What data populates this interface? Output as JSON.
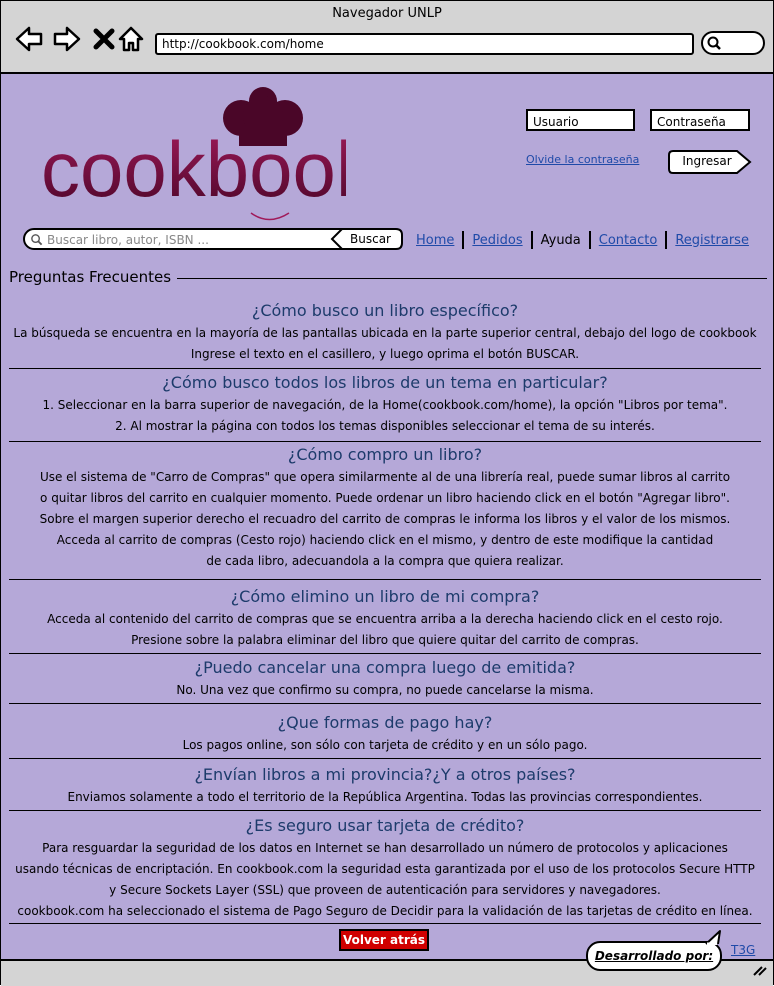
{
  "window": {
    "title": "Navegador UNLP"
  },
  "browser": {
    "url": "http://cookbook.com/home"
  },
  "logo": {
    "text": "cookbook"
  },
  "login": {
    "user_placeholder": "Usuario",
    "password_placeholder": "Contraseña",
    "forgot_label": "Olvide la contraseña",
    "login_label": "Ingresar"
  },
  "search": {
    "placeholder": "Buscar libro, autor, ISBN ...",
    "button_label": "Buscar"
  },
  "nav": {
    "home": "Home",
    "orders": "Pedidos",
    "help": "Ayuda",
    "contact": "Contacto",
    "register": "Registrarse"
  },
  "faq": {
    "heading": "Preguntas Frecuentes",
    "items": [
      {
        "q": "¿Cómo busco un libro específico?",
        "a": [
          "La búsqueda se encuentra en la mayoría de las pantallas ubicada en la parte superior central, debajo del logo de cookbook",
          "Ingrese el texto en el casillero, y luego oprima el botón BUSCAR."
        ]
      },
      {
        "q": "¿Cómo busco todos los libros de un tema en particular?",
        "a": [
          "1. Seleccionar en la barra superior de navegación, de la Home(cookbook.com/home), la opción \"Libros por tema\".",
          "2. Al mostrar la página con todos los temas disponibles seleccionar el tema de su interés."
        ]
      },
      {
        "q": "¿Cómo compro un libro?",
        "a": [
          "Use el sistema de \"Carro de Compras\" que opera similarmente al de una librería real, puede sumar libros al carrito",
          "o quitar libros del carrito en cualquier momento. Puede ordenar un libro haciendo click en el botón \"Agregar libro\".",
          "Sobre el margen superior derecho el recuadro del carrito de compras le informa los libros y el valor de los mismos.",
          "Acceda al carrito de compras (Cesto rojo) haciendo click en el mismo, y dentro de este modifique la cantidad",
          "de cada libro, adecuandola a la compra que quiera realizar."
        ]
      },
      {
        "q": "¿Cómo elimino un libro de mi compra?",
        "a": [
          "Acceda al contenido del carrito de compras que se encuentra arriba a la derecha haciendo click en el cesto rojo.",
          "Presione sobre la palabra eliminar del libro que quiere quitar del carrito de compras."
        ]
      },
      {
        "q": "¿Puedo cancelar una compra luego de emitida?",
        "a": [
          "No. Una vez que confirmo su compra, no puede cancelarse la misma."
        ]
      },
      {
        "q": "¿Que formas de pago hay?",
        "a": [
          "Los pagos online, son sólo con tarjeta de crédito y en un sólo pago."
        ]
      },
      {
        "q": "¿Envían libros a mi provincia?¿Y a otros países?",
        "a": [
          "Enviamos solamente a todo el territorio de la República Argentina. Todas las provincias correspondientes."
        ]
      },
      {
        "q": "¿Es seguro usar tarjeta de crédito?",
        "a": [
          "Para resguardar la seguridad de los datos en Internet se han desarrollado un número de protocolos y aplicaciones",
          "usando técnicas de encriptación. En cookbook.com la seguridad esta garantizada por el uso de los protocolos Secure HTTP",
          "y Secure Sockets Layer (SSL) que proveen de autenticación para servidores y navegadores.",
          "cookbook.com ha seleccionado el sistema de Pago Seguro de Decidir para la validación de las tarjetas de crédito en línea."
        ]
      }
    ]
  },
  "footer": {
    "back_label": "Volver atrás",
    "developed_by": "Desarrollado por:",
    "team": "T3G"
  },
  "colors": {
    "background": "#b5a8d8",
    "chrome": "#d4d4d4",
    "logo": "#6b0a3a",
    "link": "#1f4aa8",
    "question": "#1d3b6b",
    "back_button": "#d00000"
  }
}
